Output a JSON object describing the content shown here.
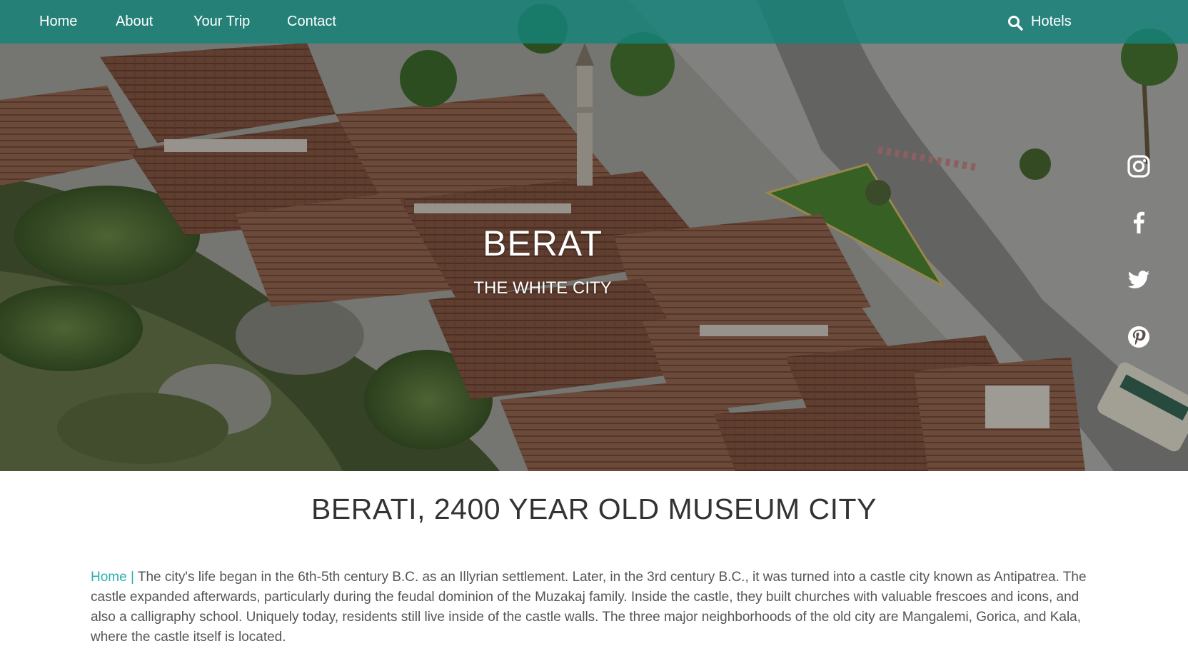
{
  "nav": {
    "items": [
      {
        "label": "Home"
      },
      {
        "label": "About"
      },
      {
        "label": "Your Trip"
      },
      {
        "label": "Contact"
      }
    ],
    "search_icon": "search-icon",
    "hotels_label": "Hotels"
  },
  "hero": {
    "title": "BERAT",
    "subtitle": "THE WHITE CITY"
  },
  "social": [
    "instagram-icon",
    "facebook-icon",
    "twitter-icon",
    "pinterest-icon"
  ],
  "content": {
    "heading": "BERATI, 2400 YEAR OLD MUSEUM CITY",
    "breadcrumb_link": "Home",
    "breadcrumb_separator": "|",
    "paragraph": "The city's life began in the 6th-5th century B.C. as an Illyrian settlement. Later, in the 3rd century B.C., it was turned into a castle city known as Antipatrea. The castle expanded afterwards, particularly during the feudal dominion of the Muzakaj family. Inside the castle, they built churches with valuable frescoes and icons, and also a calligraphy school. Uniquely today, residents still live inside of the castle walls. The three major neighborhoods of the old city are Mangalemi, Gorica, and Kala, where the castle itself is located."
  },
  "colors": {
    "nav_background": "#14847a",
    "link_accent": "#2ab0b0",
    "heading_text": "#333333",
    "body_text": "#555555"
  }
}
